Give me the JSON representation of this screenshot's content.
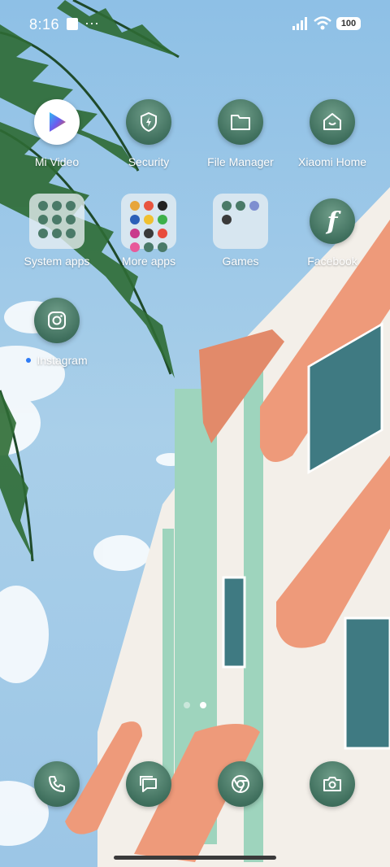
{
  "status_bar": {
    "time": "8:16",
    "more": "···",
    "battery": "100"
  },
  "apps": {
    "mi_video": {
      "label": "Mi Video",
      "icon": "mi-video-play-icon"
    },
    "security": {
      "label": "Security",
      "icon": "shield-bolt-icon"
    },
    "file_manager": {
      "label": "File Manager",
      "icon": "folder-icon"
    },
    "xiaomi_home": {
      "label": "Xiaomi Home",
      "icon": "smile-home-icon"
    },
    "system_apps": {
      "label": "System apps",
      "icon": "folder-grid-icon"
    },
    "more_apps": {
      "label": "More apps",
      "icon": "folder-grid-icon"
    },
    "games": {
      "label": "Games",
      "icon": "folder-grid-icon"
    },
    "facebook": {
      "label": "Facebook",
      "icon": "facebook-f-icon"
    },
    "instagram": {
      "label": "Instagram",
      "icon": "camera-square-icon",
      "new_badge_color": "#2f7cf6"
    }
  },
  "folders": {
    "system_apps_colors": [
      "#4a7a68",
      "#4a7a68",
      "#4a7a68",
      "#4a7a68",
      "#4a7a68",
      "#4a7a68",
      "#4a7a68",
      "#4a7a68",
      "#4a7a68"
    ],
    "more_apps_colors": [
      "#e7a53a",
      "#e8553f",
      "#222222",
      "#2b5fb8",
      "#f0c030",
      "#3cb04a",
      "#c93a8c",
      "#3a3a3a",
      "#e84c3d",
      "#e85a9a",
      "#4a7a68",
      "#4a7a68"
    ],
    "games_colors": [
      "#4a7a68",
      "#4a7a68",
      "#7e8fd0",
      "#3a3a3a"
    ]
  },
  "page_indicator": {
    "pages": 2,
    "current": 2
  },
  "dock": [
    {
      "name": "phone",
      "icon": "phone-icon"
    },
    {
      "name": "messages",
      "icon": "message-icon"
    },
    {
      "name": "chrome",
      "icon": "chrome-icon"
    },
    {
      "name": "camera",
      "icon": "camera-icon"
    }
  ],
  "colors": {
    "icon_green": "#3f6f5d",
    "sky": "#9cc6e6",
    "building_coral": "#ee9a7a",
    "building_mint": "#9ed4bd"
  }
}
